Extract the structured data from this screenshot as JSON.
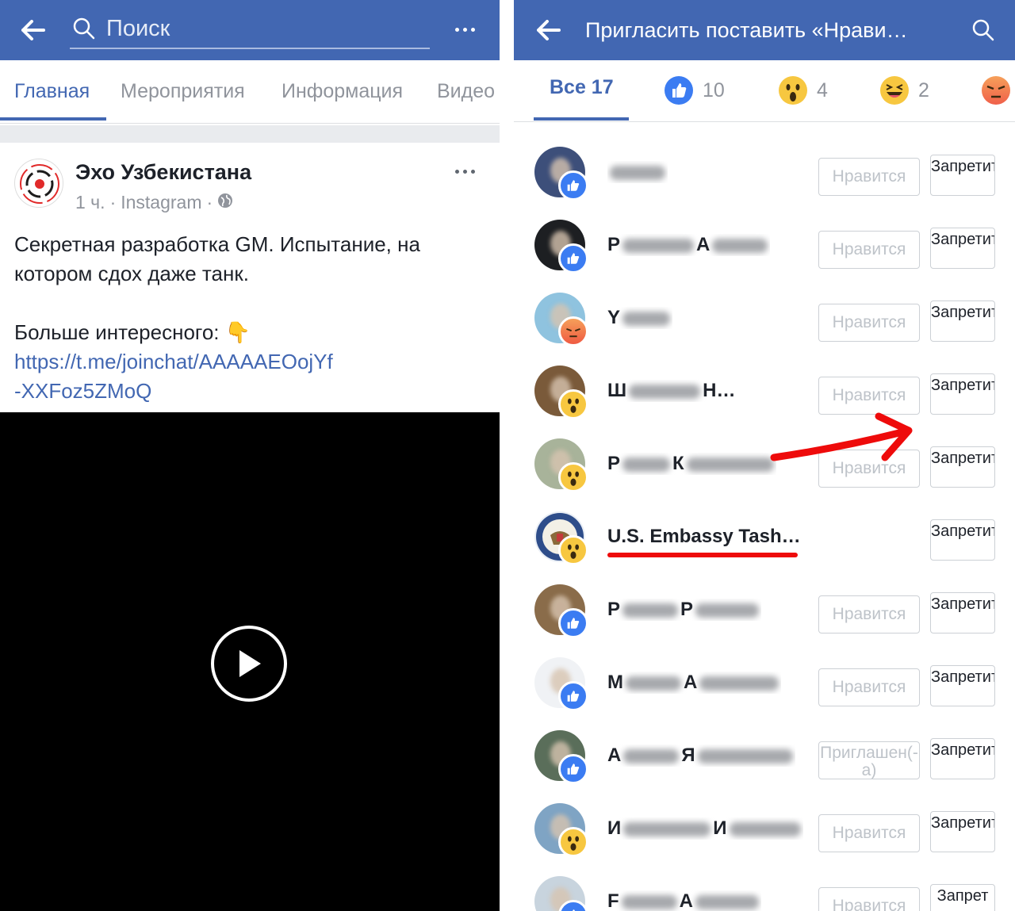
{
  "left": {
    "search": {
      "placeholder": "Поиск"
    },
    "tabs": [
      {
        "label": "Главная",
        "active": true
      },
      {
        "label": "Мероприятия",
        "active": false
      },
      {
        "label": "Информация",
        "active": false
      },
      {
        "label": "Видео",
        "active": false
      }
    ],
    "post": {
      "author": "Эхо Узбекистана",
      "meta_time": "1 ч.",
      "meta_source": "Instagram",
      "lines": [
        "Секретная разработка GM. Испытание, на",
        "котором сдох даже танк.",
        "",
        "Больше интересного: 👇"
      ],
      "link_lines": [
        "https://t.me/joinchat/AAAAAEOojYf",
        "-XXFoz5ZMoQ"
      ]
    }
  },
  "right": {
    "title": "Пригласить поставить «Нрави…",
    "tabs": [
      {
        "label": "Все 17",
        "active": true,
        "icon": "none"
      },
      {
        "label": "10",
        "active": false,
        "icon": "like-icon"
      },
      {
        "label": "4",
        "active": false,
        "icon": "wow-icon"
      },
      {
        "label": "2",
        "active": false,
        "icon": "haha-icon"
      },
      {
        "label": "",
        "active": false,
        "icon": "angry-icon"
      }
    ],
    "rows": [
      {
        "name_prefix": "",
        "name_mid": "",
        "name_suffix": "",
        "blurred": true,
        "reaction": "like",
        "action": "Нравится",
        "ban": "Запретить",
        "avatar_color": "#3d4f7a"
      },
      {
        "name_prefix": "Р",
        "name_mid": "А",
        "name_suffix": "",
        "blurred": true,
        "reaction": "like",
        "action": "Нравится",
        "ban": "Запретить",
        "avatar_color": "#1d1f22"
      },
      {
        "name_prefix": "Y",
        "name_mid": "",
        "name_suffix": "",
        "blurred": true,
        "reaction": "angry",
        "action": "Нравится",
        "ban": "Запретить",
        "avatar_color": "#8fc3df"
      },
      {
        "name_prefix": "Ш",
        "name_mid": "Н",
        "name_suffix": "",
        "blurred": true,
        "reaction": "wow",
        "action": "Нравится",
        "ban": "Запретить",
        "avatar_color": "#7a5a3a"
      },
      {
        "name_prefix": "Р",
        "name_mid": "К",
        "name_suffix": "",
        "blurred": true,
        "reaction": "wow",
        "action": "Нравится",
        "ban": "Запретить",
        "avatar_color": "#a8b39a"
      },
      {
        "name_prefix": "U.S. Embassy Tash…",
        "name_mid": "",
        "name_suffix": "",
        "blurred": false,
        "reaction": "wow",
        "action": "",
        "ban": "Запретить",
        "avatar_color": "#e9eef5"
      },
      {
        "name_prefix": "Р",
        "name_mid": "Р",
        "name_suffix": "",
        "blurred": true,
        "reaction": "like",
        "action": "Нравится",
        "ban": "Запретить",
        "avatar_color": "#8a6c4a"
      },
      {
        "name_prefix": "М",
        "name_mid": "А",
        "name_suffix": "",
        "blurred": true,
        "reaction": "like",
        "action": "Нравится",
        "ban": "Запретить",
        "avatar_color": "#f0f2f5"
      },
      {
        "name_prefix": "А",
        "name_mid": "Я",
        "name_suffix": "",
        "blurred": true,
        "reaction": "like",
        "action": "Приглашен(-а)",
        "ban": "Запретить",
        "avatar_color": "#5a6e5a"
      },
      {
        "name_prefix": "И",
        "name_mid": "И",
        "name_suffix": "",
        "blurred": true,
        "reaction": "wow",
        "action": "Нравится",
        "ban": "Запретить",
        "avatar_color": "#7fa4c4"
      },
      {
        "name_prefix": "F",
        "name_mid": "А",
        "name_suffix": "",
        "blurred": true,
        "reaction": "like",
        "action": "Нравится",
        "ban": "Запрет",
        "avatar_color": "#c8d4de"
      }
    ]
  },
  "colors": {
    "brand": "#4267b2",
    "like": "#3b7cf2",
    "wow": "#f7c740",
    "annotation": "#ee0b0b"
  }
}
